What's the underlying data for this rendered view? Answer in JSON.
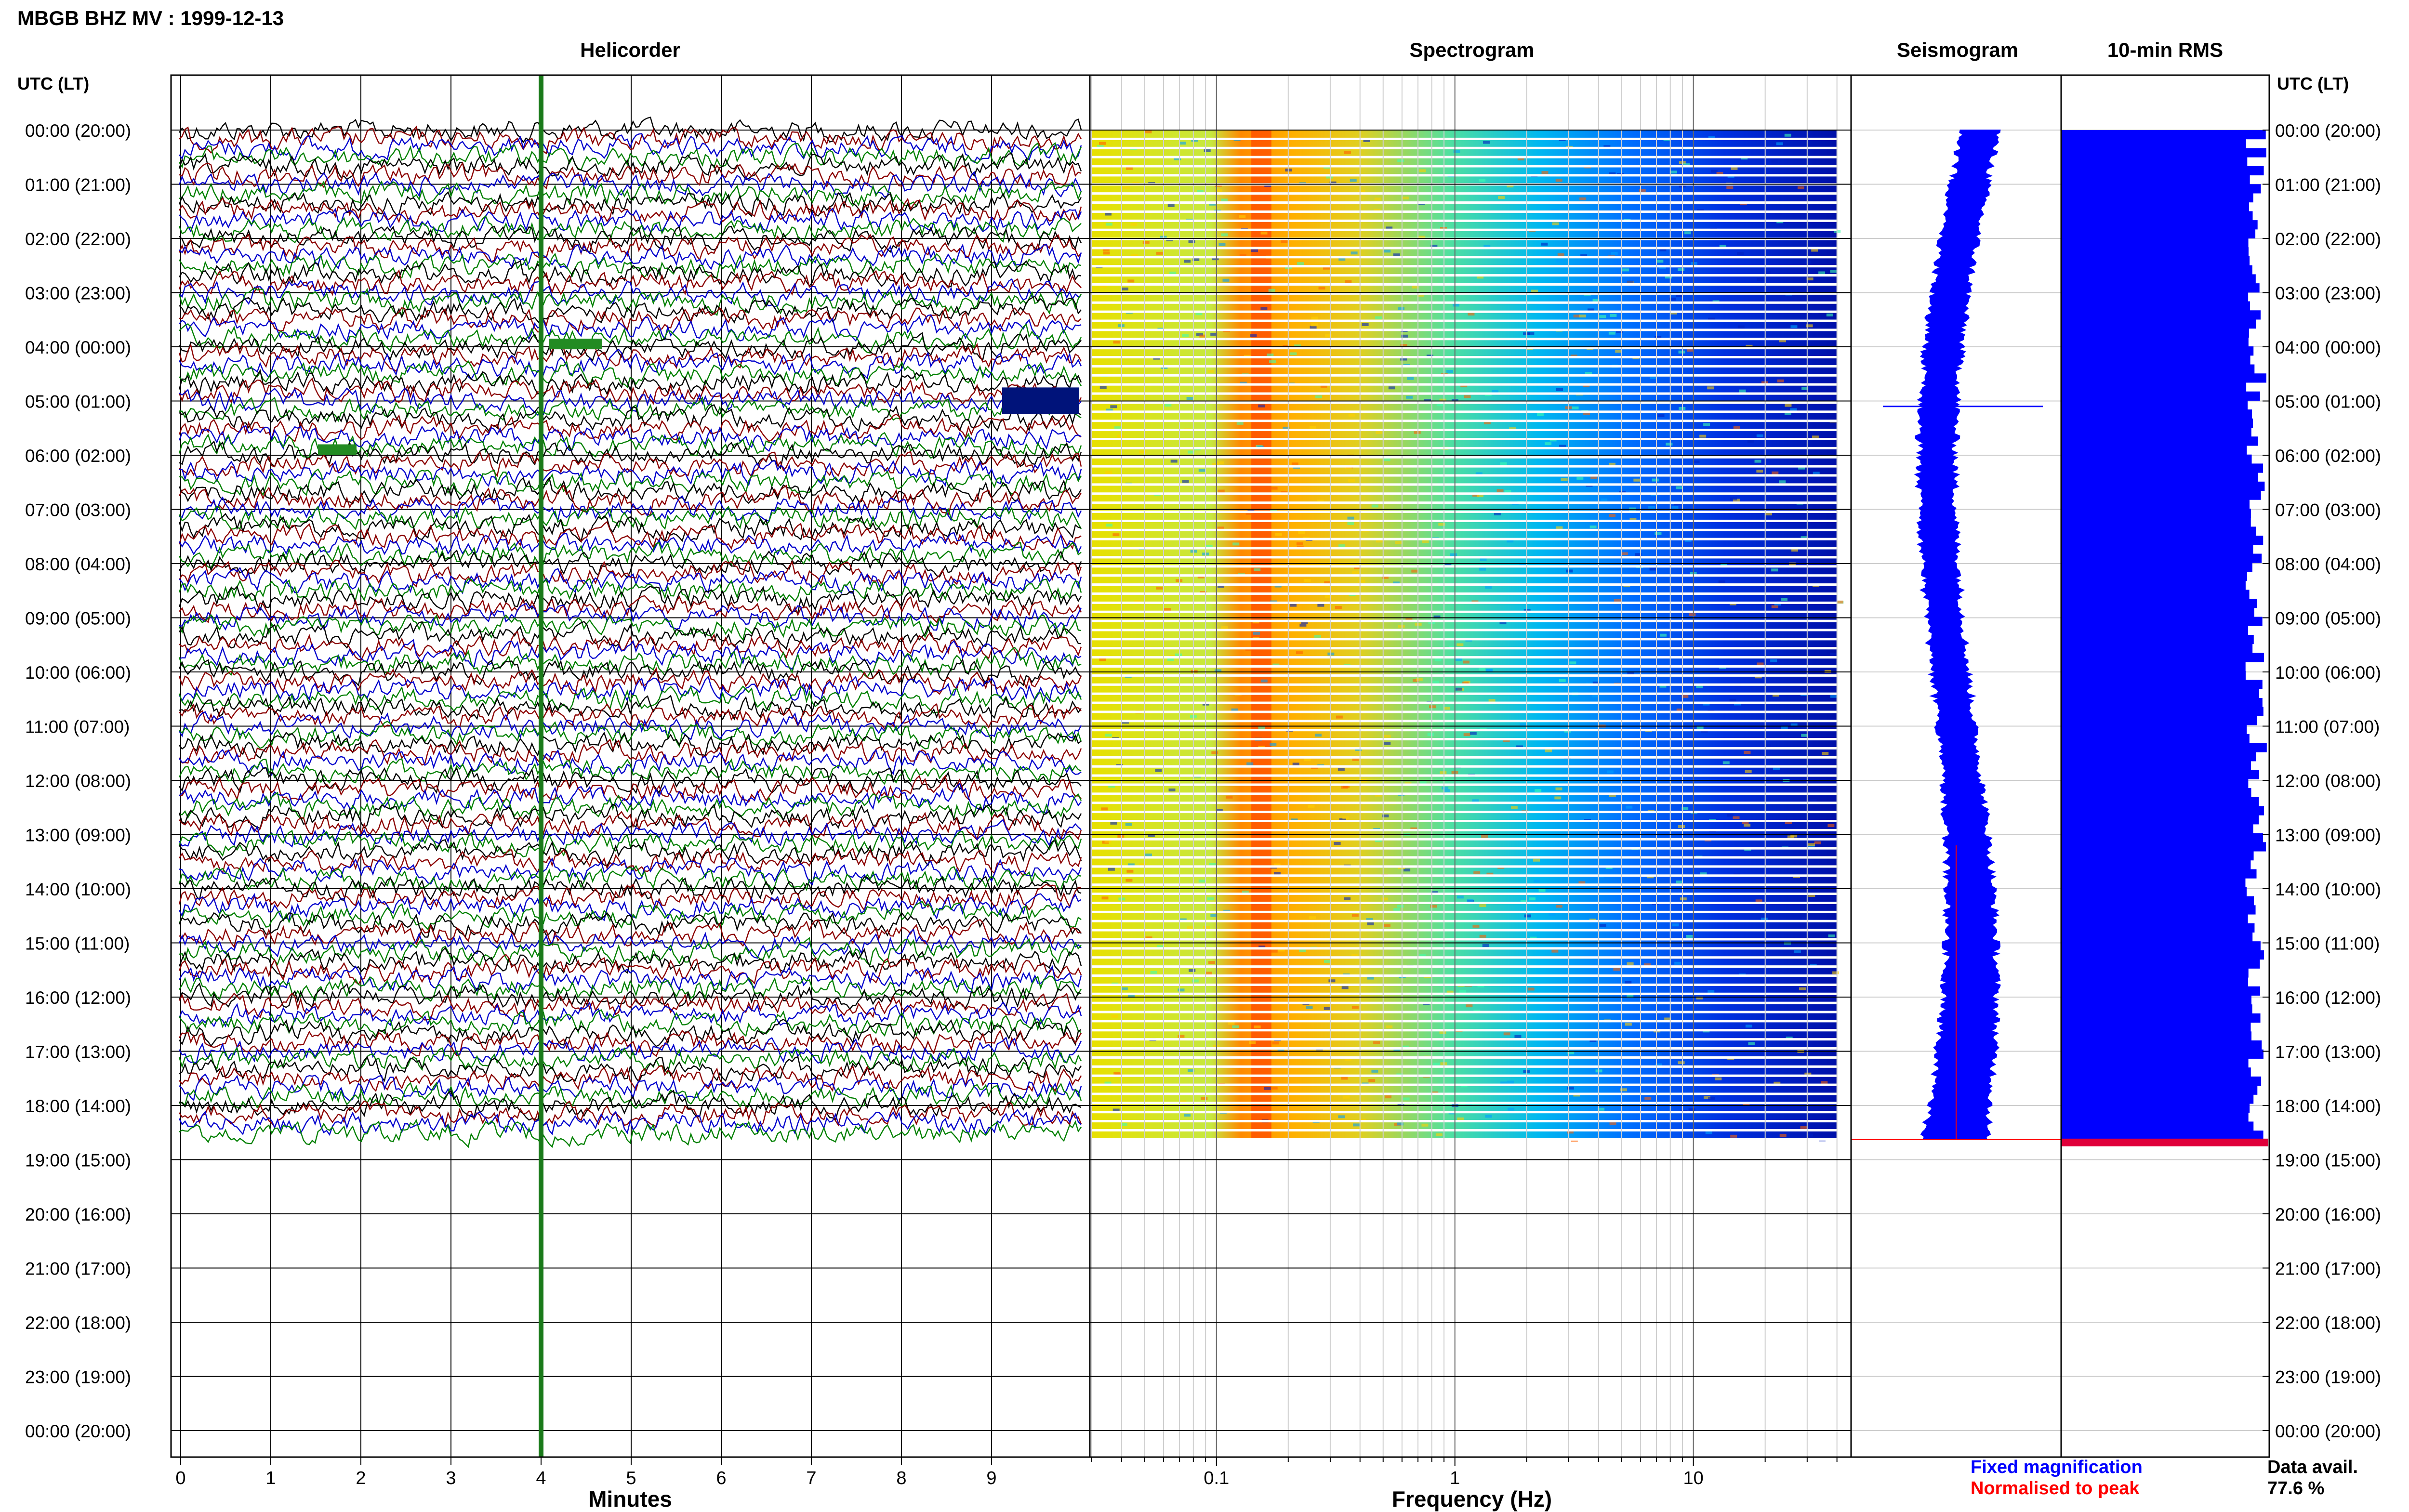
{
  "page": {
    "title": "MBGB BHZ MV : 1999-12-13",
    "time_axis_label": "UTC (LT)",
    "time_labels": [
      "00:00 (20:00)",
      "01:00 (21:00)",
      "02:00 (22:00)",
      "03:00 (23:00)",
      "04:00 (00:00)",
      "05:00 (01:00)",
      "06:00 (02:00)",
      "07:00 (03:00)",
      "08:00 (04:00)",
      "09:00 (05:00)",
      "10:00 (06:00)",
      "11:00 (07:00)",
      "12:00 (08:00)",
      "13:00 (09:00)",
      "14:00 (10:00)",
      "15:00 (11:00)",
      "16:00 (12:00)",
      "17:00 (13:00)",
      "18:00 (14:00)",
      "19:00 (15:00)",
      "20:00 (16:00)",
      "21:00 (17:00)",
      "22:00 (18:00)",
      "23:00 (19:00)",
      "00:00 (20:00)"
    ],
    "legend": {
      "fixed_label": "Fixed magnification",
      "normalised_label": "Normalised to peak",
      "fixed_color": "#0000ff",
      "normalised_color": "#ff0000"
    },
    "availability": {
      "label": "Data avail.",
      "value": "77.6 %"
    }
  },
  "chart_data": [
    {
      "type": "line",
      "title": "Helicorder",
      "xlabel": "Minutes",
      "x_ticks": [
        "0",
        "1",
        "2",
        "3",
        "4",
        "5",
        "6",
        "7",
        "8",
        "9"
      ],
      "xlim": [
        0,
        10
      ],
      "trace_colors": [
        "#000000",
        "#8b0000",
        "#0000cd",
        "#008000"
      ],
      "rows_per_hour": 6,
      "data_end_hour": 18.63,
      "marker_minute": 4,
      "marker_color": "#1a7a1a",
      "grid": true
    },
    {
      "type": "heatmap",
      "title": "Spectrogram",
      "xlabel": "Frequency (Hz)",
      "x_scale": "log",
      "x_ticks": [
        "0.1",
        "1",
        "10"
      ],
      "xlim": [
        0.03,
        45
      ],
      "data_xlim": [
        0.03,
        40
      ],
      "colormap": "jet",
      "dominant_band_hz": [
        0.14,
        0.3
      ]
    },
    {
      "type": "line",
      "title": "Seismogram",
      "color": "#0000ff",
      "spike_hour": 5.1,
      "peak_line_color": "#ff0000"
    },
    {
      "type": "bar",
      "title": "10-min RMS",
      "color": "#0000ff",
      "last_bar_color": "#e0003a",
      "bars": 112
    }
  ]
}
